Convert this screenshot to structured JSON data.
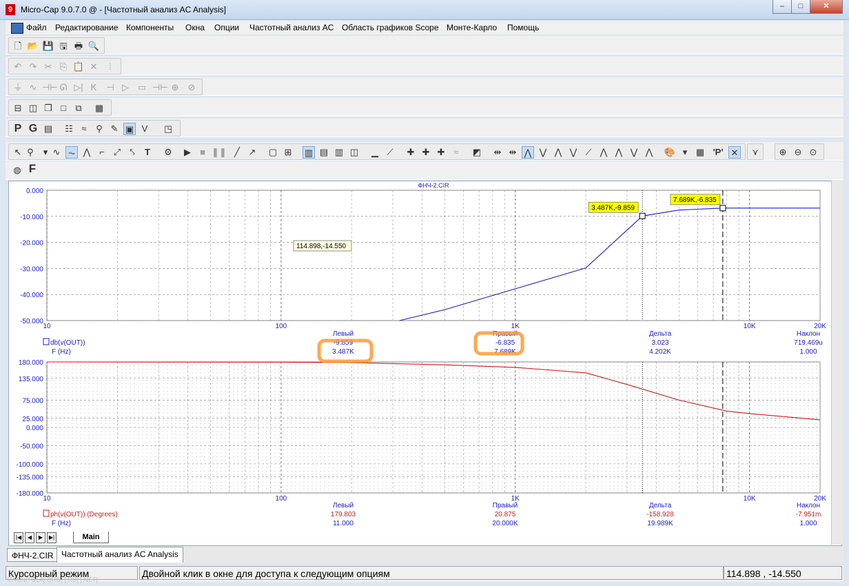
{
  "window": {
    "title": "Micro-Cap 9.0.7.0 @ - [Частотный анализ AC Analysis]",
    "app_icon": "9",
    "buttons": {
      "minimize": "–",
      "maximize": "□",
      "close": "✕"
    }
  },
  "menu": [
    "Файл",
    "Редактирование",
    "Компоненты",
    "Окна",
    "Опции",
    "Частотный анализ AC",
    "Область графиков Scope",
    "Монте-Карло",
    "Помощь"
  ],
  "toolbar": {
    "row1": [
      "new-file-icon",
      "open-file-icon",
      "save-icon",
      "save-all-icon",
      "print-icon",
      "print-preview-icon"
    ],
    "row2": [
      "undo-icon",
      "redo-icon",
      "cut-icon",
      "copy-icon",
      "paste-icon",
      "delete-icon",
      "select-all-icon"
    ],
    "row3": [
      "ground-icon",
      "resistor-icon",
      "capacitor-icon",
      "inductor-icon",
      "diode-icon",
      "npn-icon",
      "nmos-icon",
      "opamp-icon",
      "source-icon",
      "battery-icon",
      "current-source-icon",
      "voltage-source-icon"
    ],
    "row4": [
      "horizontal-tile-icon",
      "vertical-tile-icon",
      "cascade-icon",
      "maximize-icon",
      "restore-icon",
      "calculator-icon"
    ],
    "row5_text": [
      "P",
      "G"
    ],
    "row7_text": [
      "F"
    ]
  },
  "plot": {
    "file_title": "ФНЧ-2.CIR",
    "top": {
      "y_ticks": [
        "0.000",
        "-10.000",
        "-20.000",
        "-30.000",
        "-40.000",
        "-50.000"
      ],
      "y_range": [
        -50,
        0
      ],
      "x_ticks": [
        "10",
        "100",
        "1K",
        "10K",
        "20K"
      ],
      "x_range": [
        10,
        20000
      ],
      "series": {
        "name": "db(v(OUT))",
        "color": "#1c1ccc"
      },
      "label_box": "114.898,-14.550",
      "cursor_left_label": "3.487K,-9.859",
      "cursor_right_label": "7.689K,-6.835",
      "readout": {
        "hdr": [
          "Левый",
          "Правый",
          "Дельта",
          "Наклон"
        ],
        "y_name": "db(v(OUT))",
        "y_vals": [
          "-9.859",
          "-6.835",
          "3.023",
          "719.469u"
        ],
        "x_name": "F (Hz)",
        "x_vals": [
          "3.487K",
          "7.689K",
          "4.202K",
          "1.000"
        ]
      }
    },
    "bottom": {
      "y_ticks": [
        "180.000",
        "135.000",
        "75.000",
        "25.000",
        "0.000",
        "-50.000",
        "-100.000",
        "-135.000",
        "-180.000"
      ],
      "y_range": [
        -180,
        180
      ],
      "x_ticks": [
        "10",
        "100",
        "1K",
        "10K",
        "20K"
      ],
      "series": {
        "name": "ph(v(OUT)) (Degrees)",
        "color": "#cc1c1c"
      },
      "readout": {
        "hdr": [
          "Левый",
          "Правый",
          "Дельта",
          "Наклон"
        ],
        "y_name": "ph(v(OUT)) (Degrees)",
        "y_vals": [
          "179.803",
          "20.875",
          "-158.928",
          "-7.951m"
        ],
        "x_name": "F (Hz)",
        "x_vals": [
          "11.000",
          "20.000K",
          "19.989K",
          "1.000"
        ]
      }
    }
  },
  "chart_data": [
    {
      "type": "line",
      "title": "ФНЧ-2.CIR",
      "xlabel": "",
      "ylabel": "",
      "x_scale": "log",
      "xlim": [
        10,
        20000
      ],
      "ylim": [
        -50,
        0
      ],
      "grid": true,
      "series": [
        {
          "name": "db(v(OUT))",
          "color": "#1c1ccc",
          "x": [
            320,
            500,
            1000,
            2000,
            3487,
            5000,
            7689,
            10000,
            20000
          ],
          "y": [
            -50,
            -45.8,
            -37.8,
            -29.8,
            -9.859,
            -7.6,
            -6.835,
            -6.82,
            -6.82
          ]
        }
      ]
    },
    {
      "type": "line",
      "xlabel": "",
      "ylabel": "",
      "x_scale": "log",
      "xlim": [
        10,
        20000
      ],
      "ylim": [
        -180,
        180
      ],
      "grid": true,
      "series": [
        {
          "name": "ph(v(OUT)) (Degrees)",
          "color": "#cc1c1c",
          "x": [
            10,
            100,
            200,
            500,
            1000,
            2000,
            3000,
            5000,
            8000,
            10000,
            20000
          ],
          "y": [
            180,
            179.5,
            178,
            172,
            165,
            150,
            118,
            75,
            45,
            38,
            21
          ]
        }
      ]
    }
  ],
  "tabs": {
    "sheet": "Main",
    "file1": "ФНЧ-2.CIR",
    "file2": "Частотный анализ AC Analysis"
  },
  "status": {
    "mode": "Курсорный режим",
    "hint": "Двойной клик в окне для доступа к следующим опциям",
    "coords": "114.898 , -14.550"
  },
  "watermark": "MAGNITOLA[.ORG] [.RU] [.NET]"
}
